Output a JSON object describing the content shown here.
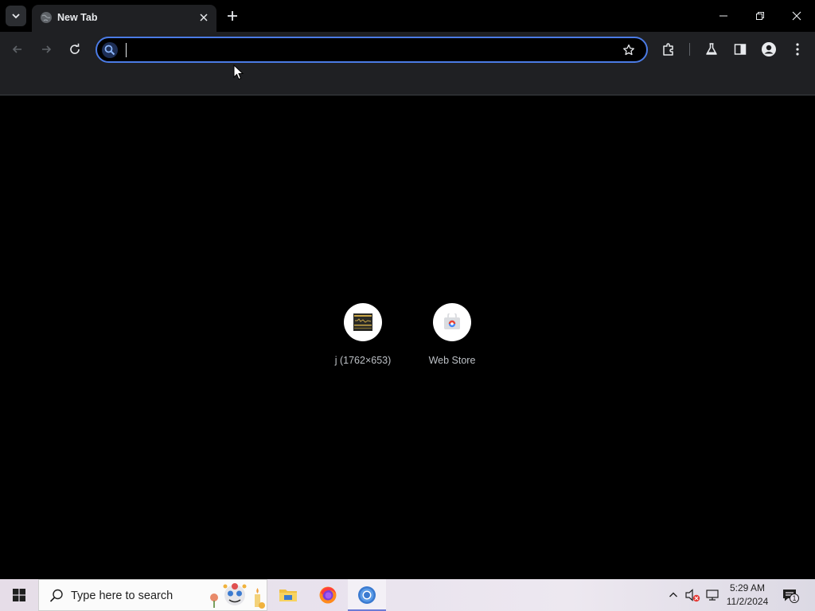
{
  "browser": {
    "tab": {
      "title": "New Tab"
    },
    "omnibox": {
      "value": "",
      "placeholder": ""
    },
    "tooltips": {
      "back": "Back",
      "forward": "Forward",
      "reload": "Reload",
      "bookmark": "Bookmark this tab",
      "extensions": "Extensions",
      "labs": "Chrome Labs",
      "side_panel": "Side panel",
      "profile": "Profile",
      "menu": "Customize and control Google Chrome"
    }
  },
  "new_tab_page": {
    "shortcuts": [
      {
        "label": "j (1762×653)",
        "icon": "image-thumbnail-icon"
      },
      {
        "label": "Web Store",
        "icon": "web-store-icon"
      }
    ]
  },
  "taskbar": {
    "search_placeholder": "Type here to search",
    "apps": [
      "file-explorer-icon",
      "firefox-icon",
      "chrome-icon"
    ],
    "clock": {
      "time": "5:29 AM",
      "date": "11/2/2024"
    },
    "notification_count": "1"
  },
  "colors": {
    "accent": "#4b7be5",
    "toolbar_bg": "#1f2023",
    "content_bg": "#000000"
  }
}
